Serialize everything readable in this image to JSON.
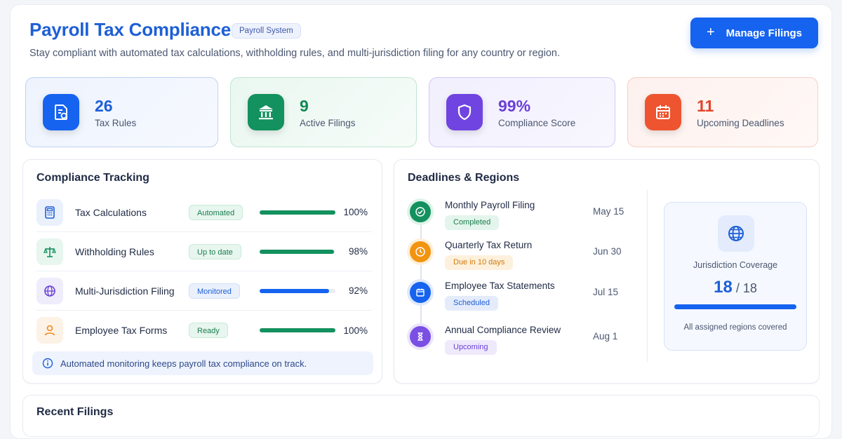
{
  "header": {
    "title": "Payroll Tax Compliance",
    "badge": "Payroll System",
    "subtitle": "Stay compliant with automated tax calculations, withholding rules, and multi-jurisdiction filing for any country or region.",
    "action_label": "Manage Filings"
  },
  "stats": [
    {
      "value": "26",
      "label": "Tax Rules",
      "color": "#1d5fd6",
      "icon": "document-icon"
    },
    {
      "value": "9",
      "label": "Active Filings",
      "color": "#0f8a55",
      "icon": "bank-icon"
    },
    {
      "value": "99%",
      "label": "Compliance Score",
      "color": "#6a3fd8",
      "icon": "shield-icon"
    },
    {
      "value": "11",
      "label": "Upcoming Deadlines",
      "color": "#e0452a",
      "icon": "calendar-icon"
    }
  ],
  "tracking": {
    "title": "Compliance Tracking",
    "items": [
      {
        "name": "Tax Calculations",
        "status": "Automated",
        "progress": 1.0,
        "percent": "100%",
        "icon": "calculator-icon",
        "bar_color": "#13915e"
      },
      {
        "name": "Withholding Rules",
        "status": "Up to date",
        "progress": 0.98,
        "percent": "98%",
        "icon": "scale-icon",
        "bar_color": "#13915e"
      },
      {
        "name": "Multi-Jurisdiction Filing",
        "status": "Monitored",
        "progress": 0.92,
        "percent": "92%",
        "icon": "globe-icon",
        "bar_color": "#1563ef"
      },
      {
        "name": "Employee Tax Forms",
        "status": "Ready",
        "progress": 1.0,
        "percent": "100%",
        "icon": "user-icon",
        "bar_color": "#13915e"
      }
    ],
    "info": "Automated monitoring keeps payroll tax compliance on track."
  },
  "deadlines": {
    "title": "Deadlines & Regions",
    "items": [
      {
        "name": "Monthly Payroll Filing",
        "status": "Completed",
        "date": "May 15",
        "icon": "check-circle-icon"
      },
      {
        "name": "Quarterly Tax Return",
        "status": "Due in 10 days",
        "date": "Jun 30",
        "icon": "clock-icon"
      },
      {
        "name": "Employee Tax Statements",
        "status": "Scheduled",
        "date": "Jul 15",
        "icon": "calendar-icon"
      },
      {
        "name": "Annual Compliance Review",
        "status": "Upcoming",
        "date": "Aug 1",
        "icon": "hourglass-icon"
      }
    ],
    "coverage": {
      "label": "Jurisdiction Coverage",
      "covered": "18",
      "total": "/ 18",
      "progress": 1.0,
      "note": "All assigned regions covered"
    }
  },
  "bottom": {
    "title": "Recent Filings"
  }
}
